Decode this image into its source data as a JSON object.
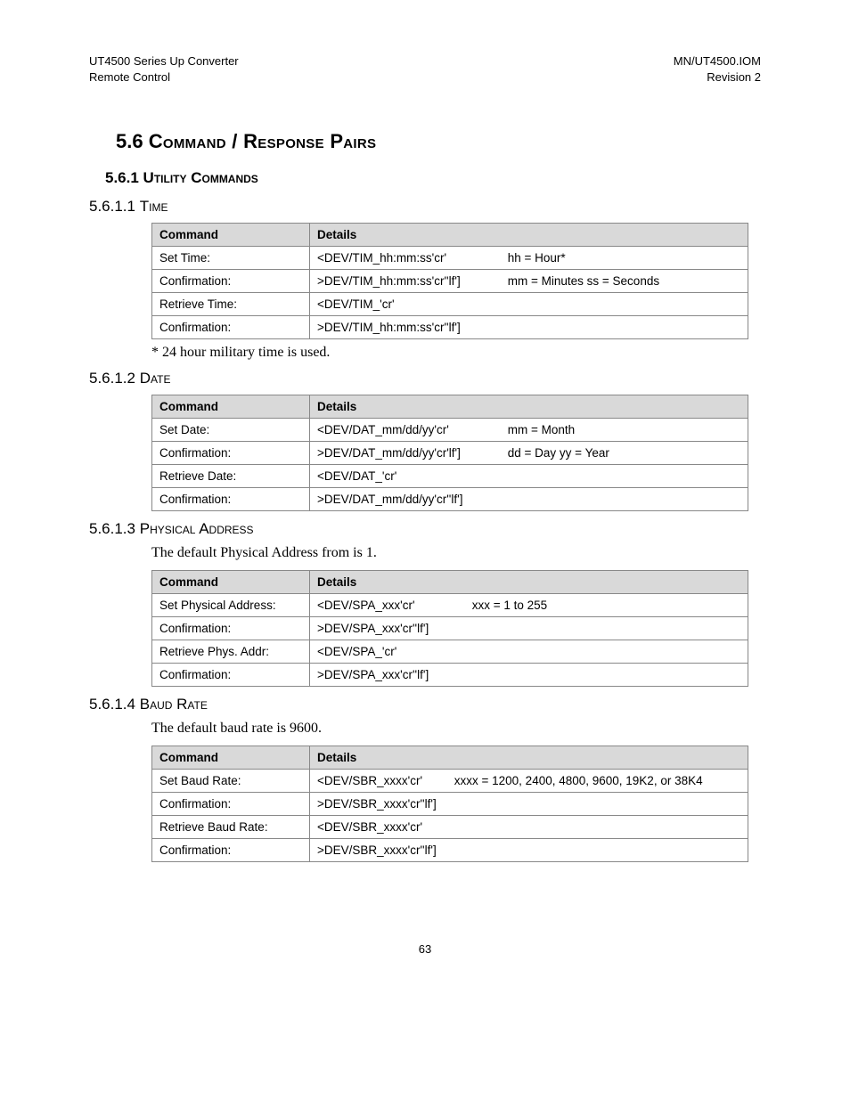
{
  "header": {
    "left1": "UT4500 Series Up Converter",
    "left2": "Remote Control",
    "right1": "MN/UT4500.IOM",
    "right2": "Revision 2"
  },
  "section": {
    "num": "5.6",
    "title": "Command / Response Pairs"
  },
  "subsection": {
    "num": "5.6.1",
    "title": "Utility Commands"
  },
  "s1": {
    "num": "5.6.1.1",
    "title": "Time",
    "th1": "Command",
    "th2": "Details",
    "r1c1": "Set Time:",
    "r1c2": "<DEV/TIM_hh:mm:ss'cr'",
    "r1c3": "hh = Hour*",
    "r2c1": "Confirmation:",
    "r2c2": ">DEV/TIM_hh:mm:ss'cr''lf']",
    "r2c3": "mm = Minutes   ss = Seconds",
    "r3c1": "Retrieve Time:",
    "r3c2": "<DEV/TIM_'cr'",
    "r4c1": "Confirmation:",
    "r4c2": ">DEV/TIM_hh:mm:ss'cr''lf']",
    "note": "* 24 hour military time is used."
  },
  "s2": {
    "num": "5.6.1.2",
    "title": "Date",
    "th1": "Command",
    "th2": "Details",
    "r1c1": "Set Date:",
    "r1c2": "<DEV/DAT_mm/dd/yy'cr'",
    "r1c3": "mm = Month",
    "r2c1": "Confirmation:",
    "r2c2": ">DEV/DAT_mm/dd/yy'cr'lf']",
    "r2c3": "dd = Day          yy = Year",
    "r3c1": "Retrieve Date:",
    "r3c2": "<DEV/DAT_'cr'",
    "r4c1": "Confirmation:",
    "r4c2": ">DEV/DAT_mm/dd/yy'cr''lf']"
  },
  "s3": {
    "num": "5.6.1.3",
    "title": "Physical Address",
    "intro": "The default Physical Address from is 1.",
    "th1": "Command",
    "th2": "Details",
    "r1c1": "Set Physical Address:",
    "r1c2": "<DEV/SPA_xxx'cr'",
    "r1c3": "xxx = 1 to 255",
    "r2c1": "Confirmation:",
    "r2c2": ">DEV/SPA_xxx'cr''lf']",
    "r3c1": "Retrieve Phys. Addr:",
    "r3c2": "<DEV/SPA_'cr'",
    "r4c1": "Confirmation:",
    "r4c2": ">DEV/SPA_xxx'cr''lf']"
  },
  "s4": {
    "num": "5.6.1.4",
    "title": "Baud Rate",
    "intro": "The default baud rate is 9600.",
    "th1": "Command",
    "th2": "Details",
    "r1c1": "Set Baud Rate:",
    "r1c2": "<DEV/SBR_xxxx'cr'",
    "r1c3": "xxxx = 1200, 2400, 4800, 9600, 19K2, or 38K4",
    "r2c1": "Confirmation:",
    "r2c2": ">DEV/SBR_xxxx'cr''lf']",
    "r3c1": "Retrieve Baud Rate:",
    "r3c2": "<DEV/SBR_xxxx'cr'",
    "r4c1": "Confirmation:",
    "r4c2": ">DEV/SBR_xxxx'cr''lf']"
  },
  "pagenum": "63"
}
